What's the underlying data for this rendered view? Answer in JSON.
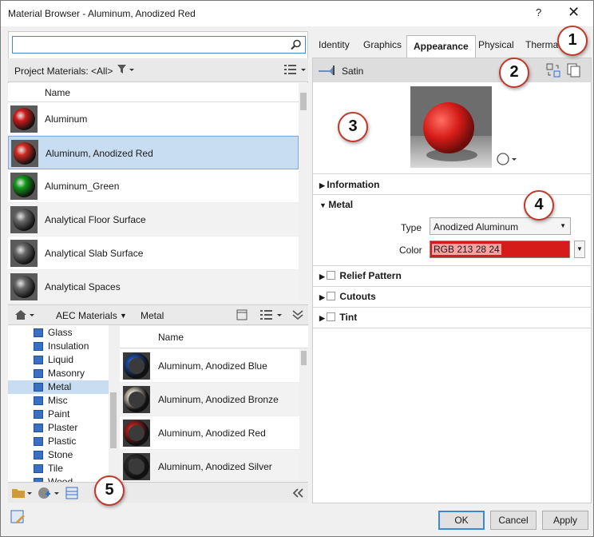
{
  "window": {
    "title": "Material Browser - Aluminum, Anodized Red",
    "help": "?",
    "close": "✕"
  },
  "search": {
    "placeholder": ""
  },
  "project": {
    "label": "Project Materials: <All>",
    "filter_icon": "funnel-icon",
    "view_icon": "list-view-icon"
  },
  "materials": {
    "column": "Name",
    "items": [
      {
        "name": "Aluminum",
        "color": "#d21b1b",
        "selected": false
      },
      {
        "name": "Aluminum, Anodized Red",
        "color": "#d52a22",
        "selected": true
      },
      {
        "name": "Aluminum_Green",
        "color": "#139a1a",
        "selected": false
      },
      {
        "name": "Analytical Floor Surface",
        "color": "#6a6a6a",
        "selected": false
      },
      {
        "name": "Analytical Slab Surface",
        "color": "#6a6a6a",
        "selected": false
      },
      {
        "name": "Analytical Spaces",
        "color": "#6a6a6a",
        "selected": false
      }
    ]
  },
  "library": {
    "breadcrumb": [
      "AEC Materials",
      "Metal"
    ],
    "tree": [
      "Glass",
      "Insulation",
      "Liquid",
      "Masonry",
      "Metal",
      "Misc",
      "Paint",
      "Plaster",
      "Plastic",
      "Stone",
      "Tile",
      "Wood"
    ],
    "selected_category": "Metal",
    "column": "Name",
    "items": [
      {
        "name": "Aluminum, Anodized Blue",
        "color": "#1f4ea8"
      },
      {
        "name": "Aluminum, Anodized Bronze",
        "color": "#d8cfc2"
      },
      {
        "name": "Aluminum, Anodized Red",
        "color": "#b3201b"
      },
      {
        "name": "Aluminum, Anodized Silver",
        "color": "#2b2b2b"
      }
    ]
  },
  "tabs": [
    "Identity",
    "Graphics",
    "Appearance",
    "Physical",
    "Therma"
  ],
  "active_tab": "Appearance",
  "appearance": {
    "asset_name": "Satin",
    "information_label": "Information",
    "metal_label": "Metal",
    "type_label": "Type",
    "type_value": "Anodized Aluminum",
    "color_label": "Color",
    "color_value": "RGB 213 28 24",
    "color_hex": "#d51c18",
    "relief_label": "Relief Pattern",
    "cutouts_label": "Cutouts",
    "tint_label": "Tint"
  },
  "callouts": [
    "1",
    "2",
    "3",
    "4",
    "5"
  ],
  "buttons": {
    "ok": "OK",
    "cancel": "Cancel",
    "apply": "Apply"
  }
}
